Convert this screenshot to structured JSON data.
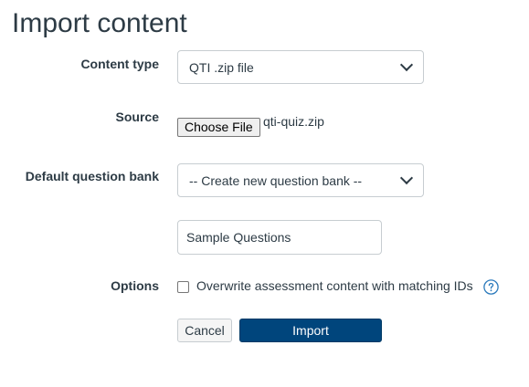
{
  "page": {
    "title": "Import content"
  },
  "form": {
    "content_type": {
      "label": "Content type",
      "selected": "QTI .zip file"
    },
    "source": {
      "label": "Source",
      "button_label": "Choose File",
      "file_name": "qti-quiz.zip"
    },
    "question_bank": {
      "label": "Default question bank",
      "selected": "-- Create new question bank --",
      "new_bank_name": "Sample Questions"
    },
    "options": {
      "label": "Options",
      "overwrite_label": "Overwrite assessment content with matching IDs",
      "overwrite_checked": false
    }
  },
  "actions": {
    "cancel_label": "Cancel",
    "import_label": "Import"
  },
  "colors": {
    "primary": "#00457c",
    "text": "#2d3b45",
    "help_icon": "#2b7abc"
  },
  "icons": {
    "dropdown": "chevron-down-icon",
    "help": "question-mark-icon"
  }
}
